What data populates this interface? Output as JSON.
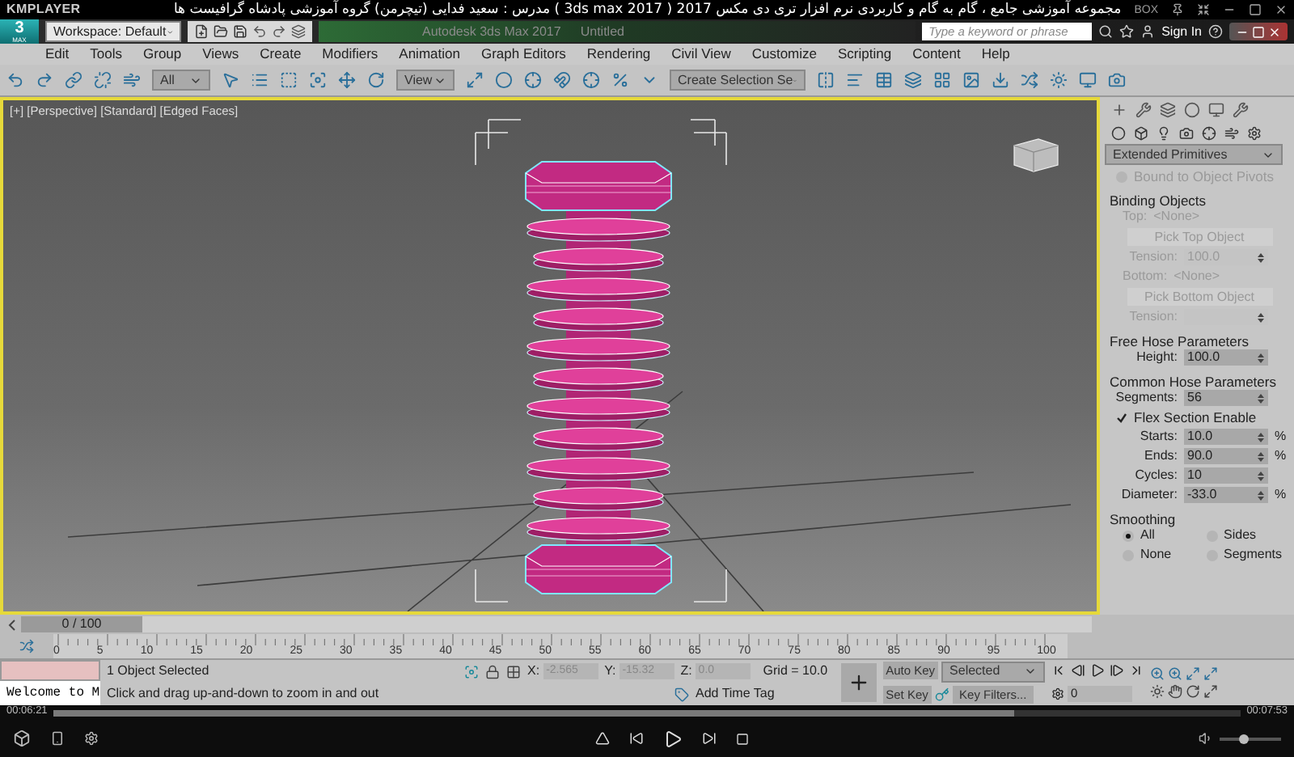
{
  "player": {
    "brand": "KMPLAYER",
    "title": "مجموعه آموزشی جامع ، گام به گام و کاربردی نرم افزار تری دی مکس 2017 ( 3ds max 2017 ) مدرس : سعید فدایی (تیچرمن) گروه آموزشی پادشاه گرافیست ها",
    "box": "BOX",
    "elapsed": "00:06:21",
    "total": "00:07:53",
    "level": 0.81,
    "volume": {
      "level": 0.4
    }
  },
  "app_title": {
    "logo": "3",
    "logo_sub": "MAX",
    "workspace": "Workspace: Default",
    "app": "Autodesk 3ds Max 2017",
    "doc": "Untitled",
    "search": {
      "placeholder": "Type a keyword or phrase"
    },
    "sign_in": "Sign In"
  },
  "menu": [
    "Edit",
    "Tools",
    "Group",
    "Views",
    "Create",
    "Modifiers",
    "Animation",
    "Graph Editors",
    "Rendering",
    "Civil View",
    "Customize",
    "Scripting",
    "Content",
    "Help"
  ],
  "toolbar": {
    "filter": "All",
    "ref_coord": "View",
    "selection_set": "Create Selection Se"
  },
  "viewport": {
    "label": "[+] [Perspective] [Standard] [Edged Faces]"
  },
  "command_panel": {
    "category": "Extended Primitives",
    "rows": [
      {
        "kind": "checkbox",
        "label": "Bound to Object Pivots",
        "checked": false,
        "disabled": true
      },
      {
        "kind": "heading",
        "label": "Binding Objects"
      },
      {
        "kind": "value",
        "label": "Top:",
        "value": "<None>",
        "disabled": true
      },
      {
        "kind": "button",
        "label": "Pick Top Object",
        "disabled": true
      },
      {
        "kind": "spinner",
        "label": "Tension:",
        "value": "100.0",
        "disabled": true
      },
      {
        "kind": "value",
        "label": "Bottom:",
        "value": "<None>",
        "disabled": true
      },
      {
        "kind": "button",
        "label": "Pick Bottom Object",
        "disabled": true
      },
      {
        "kind": "spinner",
        "label": "Tension:",
        "disabled": true
      },
      {
        "kind": "heading",
        "label": "Free Hose Parameters"
      },
      {
        "kind": "spinner",
        "label": "Height:",
        "value": "100.0",
        "disabled": false
      },
      {
        "kind": "heading",
        "label": "Common Hose Parameters"
      },
      {
        "kind": "spinner",
        "label": "Segments:",
        "value": "56",
        "disabled": false
      },
      {
        "kind": "checkbox",
        "label": "Flex Section Enable",
        "checked": true,
        "disabled": false
      },
      {
        "kind": "spinner",
        "label": "Starts:",
        "value": "10.0",
        "unit": "%",
        "disabled": false
      },
      {
        "kind": "spinner",
        "label": "Ends:",
        "value": "90.0",
        "unit": "%",
        "disabled": false
      },
      {
        "kind": "spinner",
        "label": "Cycles:",
        "value": "10",
        "disabled": false
      },
      {
        "kind": "spinner",
        "label": "Diameter:",
        "value": "-33.0",
        "unit": "%",
        "disabled": false
      },
      {
        "kind": "heading",
        "label": "Smoothing"
      },
      {
        "kind": "radios",
        "options": [
          {
            "label": "All",
            "selected": true
          },
          {
            "label": "Sides",
            "selected": false
          },
          {
            "label": "None",
            "selected": false
          },
          {
            "label": "Segments",
            "selected": false
          }
        ]
      }
    ]
  },
  "time_slider": {
    "reading": "0 / 100"
  },
  "track_bar": {
    "ticks": [
      "0",
      "5",
      "10",
      "15",
      "20",
      "25",
      "30",
      "35",
      "40",
      "45",
      "50",
      "55",
      "60",
      "65",
      "70",
      "75",
      "80",
      "85",
      "90",
      "95",
      "100"
    ]
  },
  "status": {
    "listener": "Welcome to M",
    "selection": "1 Object Selected",
    "prompt": "Click and drag up-and-down to zoom in and out",
    "coords": [
      {
        "label": "X:",
        "value": "-2.565"
      },
      {
        "label": "Y:",
        "value": "-15.32"
      },
      {
        "label": "Z:",
        "value": "0.0"
      }
    ],
    "grid": "Grid = 10.0",
    "time_tag": "Add Time Tag"
  },
  "animation": {
    "auto_key": "Auto Key",
    "key_mode": "Selected",
    "set_key": "Set Key",
    "key_filters": "Key Filters...",
    "frame": "0"
  }
}
